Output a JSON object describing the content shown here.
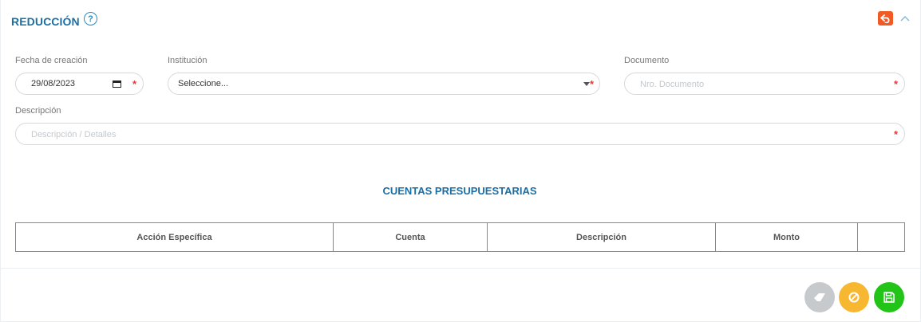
{
  "header": {
    "title": "REDUCCIÓN",
    "help_icon": "question-circle-icon",
    "back_icon": "undo-arrow-icon",
    "collapse_icon": "chevron-up-icon",
    "colors": {
      "title": "#1a6fa7",
      "back": "#f15a24"
    }
  },
  "form": {
    "fecha": {
      "label": "Fecha de creación",
      "value": "29/08/2023",
      "required_mark": "*"
    },
    "institucion": {
      "label": "Institución",
      "value": "Seleccione...",
      "required_mark": "*"
    },
    "documento": {
      "label": "Documento",
      "placeholder": "Nro. Documento",
      "required_mark": "*"
    },
    "descripcion": {
      "label": "Descripción",
      "placeholder": "Descripción / Detalles",
      "required_mark": "*"
    }
  },
  "cuentas": {
    "title": "CUENTAS PRESUPUESTARIAS",
    "columns": [
      "Acción Específica",
      "Cuenta",
      "Descripción",
      "Monto",
      ""
    ]
  },
  "footer": {
    "buttons": [
      {
        "name": "clear",
        "icon": "eraser-icon",
        "color": "#c7cacc"
      },
      {
        "name": "cancel",
        "icon": "ban-icon",
        "color": "#f7b731"
      },
      {
        "name": "save",
        "icon": "floppy-disk-icon",
        "color": "#22c418"
      }
    ]
  }
}
